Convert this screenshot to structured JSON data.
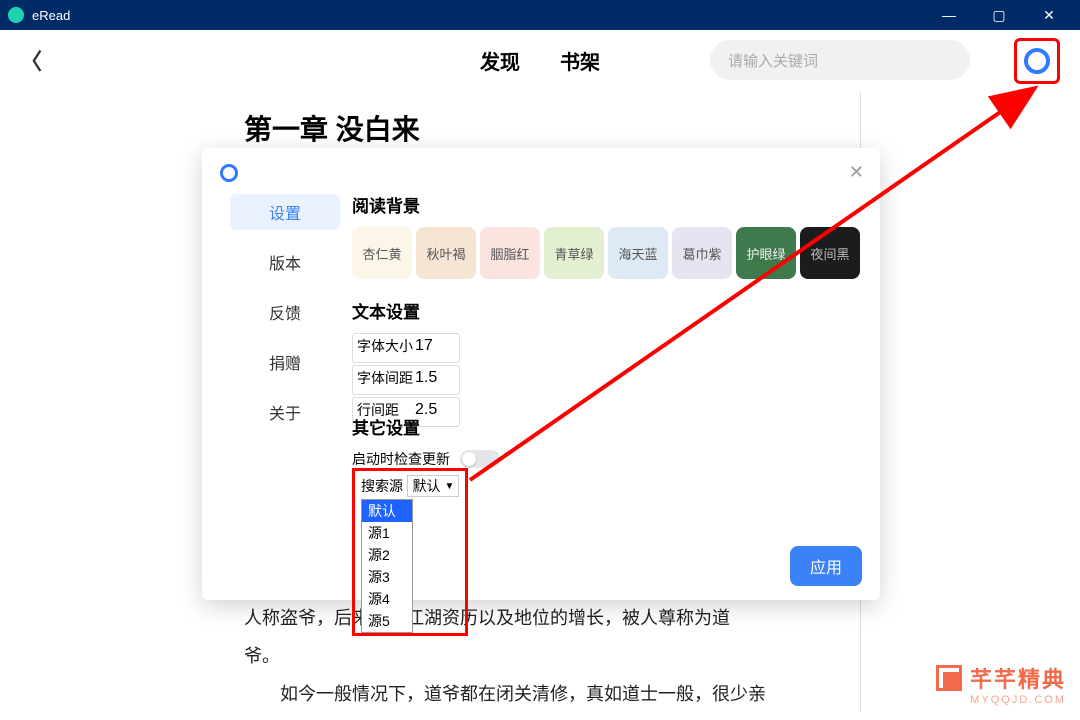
{
  "app": {
    "title": "eRead"
  },
  "nav": {
    "discover": "发现",
    "shelf": "书架"
  },
  "search": {
    "placeholder": "请输入关键词"
  },
  "chapter": {
    "title": "第一章 没白来"
  },
  "bg_text": {
    "line1": "人称盗爷，后来随着江湖资历以及地位的增长，被人尊称为道",
    "line2": "爷。",
    "line3": "如今一般情况下，道爷都在闭关清修，真如道士一般，很少亲"
  },
  "sidebar": {
    "items": [
      {
        "label": "设置"
      },
      {
        "label": "版本"
      },
      {
        "label": "反馈"
      },
      {
        "label": "捐赠"
      },
      {
        "label": "关于"
      }
    ]
  },
  "sections": {
    "bg": "阅读背景",
    "text": "文本设置",
    "other": "其它设置"
  },
  "bg_colors": [
    {
      "name": "杏仁黄",
      "bg": "#fcf6e8",
      "fg": "#555"
    },
    {
      "name": "秋叶褐",
      "bg": "#f6e5d3",
      "fg": "#555"
    },
    {
      "name": "胭脂红",
      "bg": "#fbe3e0",
      "fg": "#555"
    },
    {
      "name": "青草绿",
      "bg": "#e3f0cf",
      "fg": "#555"
    },
    {
      "name": "海天蓝",
      "bg": "#dde9f5",
      "fg": "#555"
    },
    {
      "name": "葛巾紫",
      "bg": "#e8e3f1",
      "fg": "#555"
    },
    {
      "name": "护眼绿",
      "bg": "#3f7a4d",
      "fg": "#eee"
    },
    {
      "name": "夜间黑",
      "bg": "#1b1c1e",
      "fg": "#bbb"
    }
  ],
  "text_settings": {
    "font_size_label": "字体大小",
    "font_size": "17",
    "letter_spacing_label": "字体间距",
    "letter_spacing": "1.5",
    "line_height_label": "行间距",
    "line_height": "2.5"
  },
  "other": {
    "check_update": "启动时检查更新",
    "source_label": "搜索源",
    "source_selected": "默认",
    "options": [
      "默认",
      "源1",
      "源2",
      "源3",
      "源4",
      "源5"
    ]
  },
  "apply": "应用",
  "watermark": {
    "main": "芊芊精典",
    "sub": "MYQQJD.COM"
  }
}
